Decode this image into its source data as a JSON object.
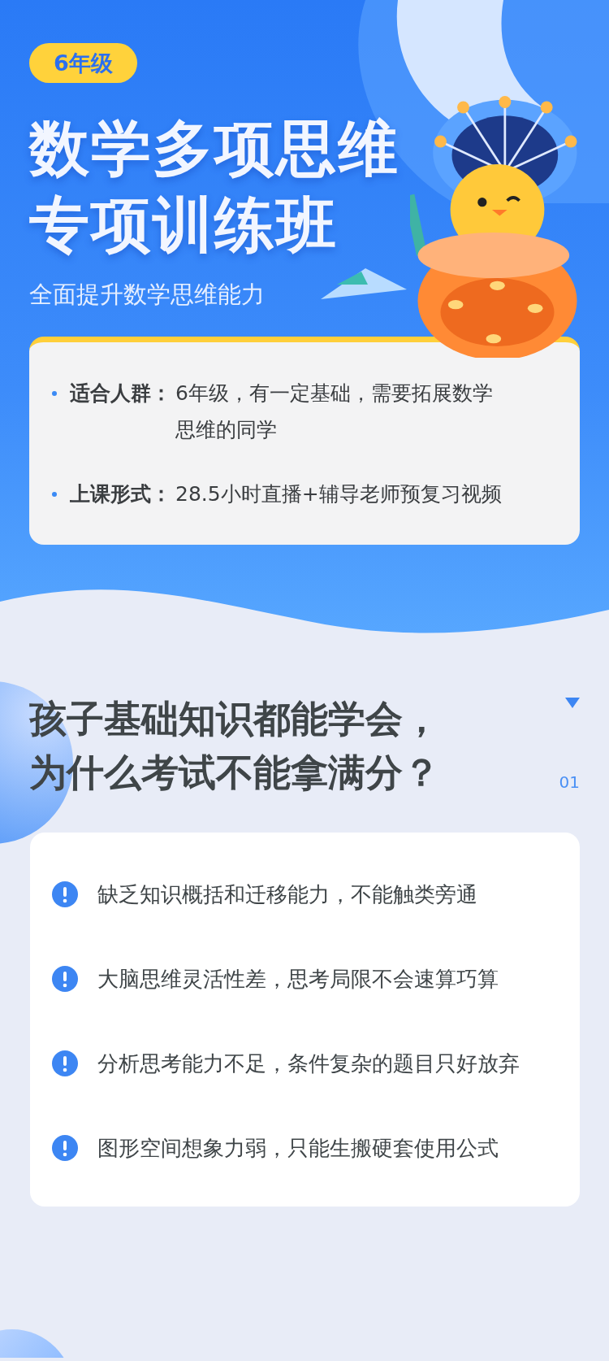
{
  "grade_badge": "6年级",
  "title_lines": [
    "数学多项思维",
    "专项训练班"
  ],
  "subtitle": "全面提升数学思维能力",
  "info": [
    {
      "label": "适合人群：",
      "value": "6年级，有一定基础，需要拓展数学思维的同学"
    },
    {
      "label": "上课形式：",
      "value": "28.5小时直播+辅导老师预复习视频"
    }
  ],
  "section": {
    "heading_lines": [
      "孩子基础知识都能学会，",
      "为什么考试不能拿满分？"
    ],
    "number": "01"
  },
  "problems": [
    "缺乏知识概括和迁移能力，不能触类旁通",
    "大脑思维灵活性差，思考局限不会速算巧算",
    "分析思考能力不足，条件复杂的题目只好放弃",
    "图形空间想象力弱，只能生搬硬套使用公式"
  ]
}
